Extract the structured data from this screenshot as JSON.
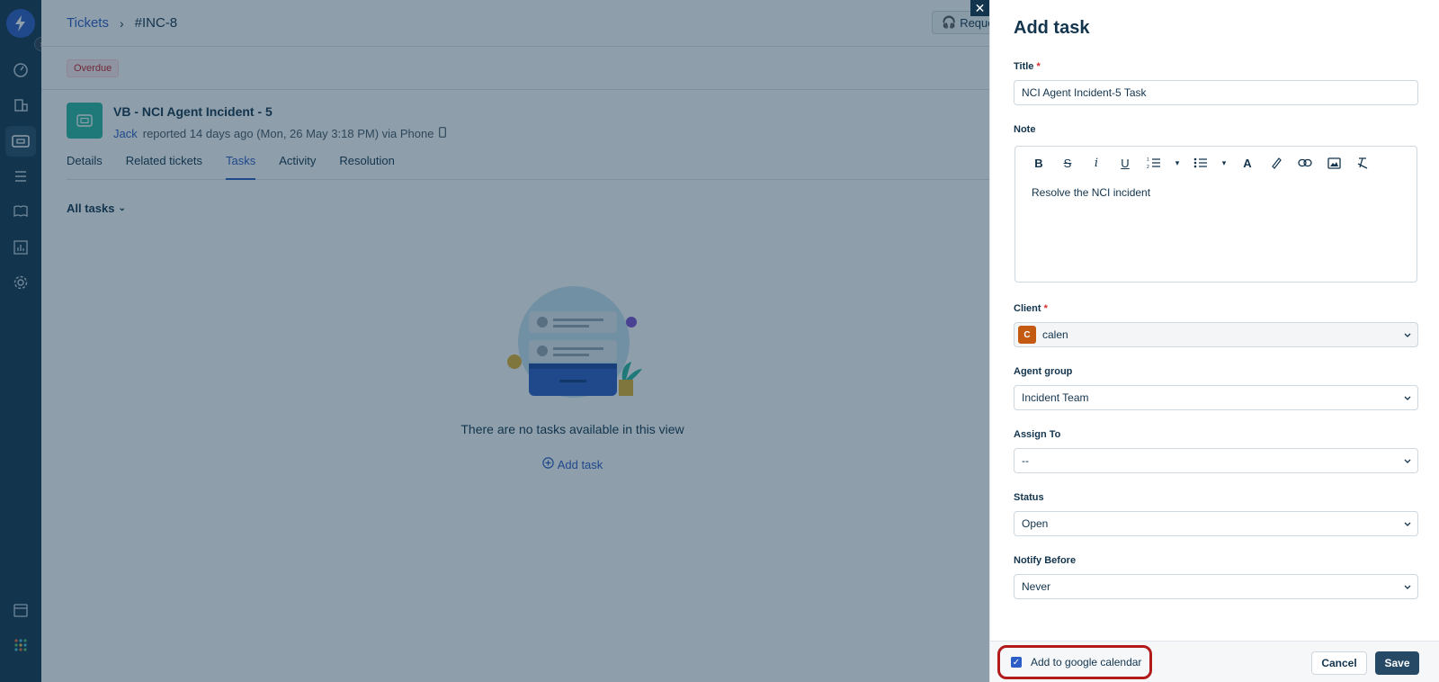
{
  "nav": {
    "items": [
      "dashboard",
      "assets",
      "tickets",
      "tasks",
      "solutions",
      "reports",
      "admin",
      "apps"
    ]
  },
  "header": {
    "breadcrumb_root": "Tickets",
    "breadcrumb_current": "#INC-8",
    "request_button": "Reque"
  },
  "ticket": {
    "status_badge": "Overdue",
    "title": "VB - NCI Agent Incident - 5",
    "reporter": "Jack",
    "meta": "reported 14 days ago (Mon, 26 May 3:18 PM) via Phone"
  },
  "tabs": [
    "Details",
    "Related tickets",
    "Tasks",
    "Activity",
    "Resolution"
  ],
  "active_tab": "Tasks",
  "filter": {
    "label": "All tasks"
  },
  "empty_state": {
    "message": "There are no tasks available in this view",
    "add_link": "Add task"
  },
  "drawer": {
    "title": "Add task",
    "fields": {
      "title_label": "Title",
      "title_value": "NCI Agent Incident-5 Task",
      "note_label": "Note",
      "note_value": "Resolve the NCI incident",
      "client_label": "Client",
      "client_avatar": "C",
      "client_value": "calen",
      "agent_group_label": "Agent group",
      "agent_group_value": "Incident Team",
      "assign_label": "Assign To",
      "assign_value": "--",
      "status_label": "Status",
      "status_value": "Open",
      "notify_label": "Notify Before",
      "notify_value": "Never"
    },
    "required_mark": "*",
    "toolbar_icons": [
      "bold-icon",
      "strikethrough-icon",
      "italic-icon",
      "underline-icon",
      "ordered-list-icon",
      "ordered-list-dropdown-icon",
      "bullet-list-icon",
      "bullet-list-dropdown-icon",
      "text-color-icon",
      "highlight-icon",
      "link-icon",
      "image-icon",
      "clear-format-icon"
    ],
    "footer": {
      "calendar_label": "Add to google calendar",
      "calendar_checked": true,
      "cancel": "Cancel",
      "save": "Save"
    }
  },
  "colors": {
    "brand": "#2c5cc5",
    "nav_bg": "#12344d",
    "highlight_ring": "#b31b1b",
    "save_bg": "#264966"
  }
}
